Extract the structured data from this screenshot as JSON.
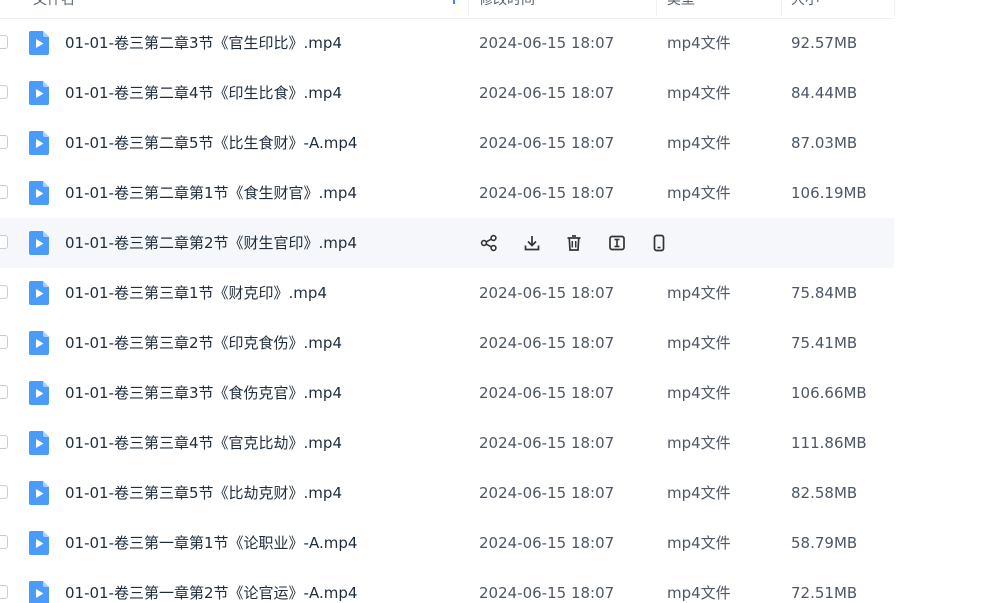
{
  "header": {
    "name_label": "文件名",
    "modified_label": "修改时间",
    "type_label": "类型",
    "size_label": "大小"
  },
  "colors": {
    "accent": "#3b8cf7",
    "icon_blue": "#4a9cf8",
    "hover_row": "#f5f7fa"
  },
  "rows": [
    {
      "name": "01-01-卷三第二章3节《官生印比》.mp4",
      "modified": "2024-06-15 18:07",
      "type": "mp4文件",
      "size": "92.57MB"
    },
    {
      "name": "01-01-卷三第二章4节《印生比食》.mp4",
      "modified": "2024-06-15 18:07",
      "type": "mp4文件",
      "size": "84.44MB"
    },
    {
      "name": "01-01-卷三第二章5节《比生食财》-A.mp4",
      "modified": "2024-06-15 18:07",
      "type": "mp4文件",
      "size": "87.03MB"
    },
    {
      "name": "01-01-卷三第二章第1节《食生财官》.mp4",
      "modified": "2024-06-15 18:07",
      "type": "mp4文件",
      "size": "106.19MB"
    },
    {
      "name": "01-01-卷三第二章第2节《财生官印》.mp4",
      "modified": "",
      "type": "",
      "size": "",
      "hover": true
    },
    {
      "name": "01-01-卷三第三章1节《财克印》.mp4",
      "modified": "2024-06-15 18:07",
      "type": "mp4文件",
      "size": "75.84MB"
    },
    {
      "name": "01-01-卷三第三章2节《印克食伤》.mp4",
      "modified": "2024-06-15 18:07",
      "type": "mp4文件",
      "size": "75.41MB"
    },
    {
      "name": "01-01-卷三第三章3节《食伤克官》.mp4",
      "modified": "2024-06-15 18:07",
      "type": "mp4文件",
      "size": "106.66MB"
    },
    {
      "name": "01-01-卷三第三章4节《官克比劫》.mp4",
      "modified": "2024-06-15 18:07",
      "type": "mp4文件",
      "size": "111.86MB"
    },
    {
      "name": "01-01-卷三第三章5节《比劫克财》.mp4",
      "modified": "2024-06-15 18:07",
      "type": "mp4文件",
      "size": "82.58MB"
    },
    {
      "name": "01-01-卷三第一章第1节《论职业》-A.mp4",
      "modified": "2024-06-15 18:07",
      "type": "mp4文件",
      "size": "58.79MB"
    },
    {
      "name": "01-01-卷三第一章第2节《论官运》-A.mp4",
      "modified": "2024-06-15 18:07",
      "type": "mp4文件",
      "size": "72.51MB"
    }
  ],
  "row_actions": [
    {
      "name": "share-icon"
    },
    {
      "name": "download-icon"
    },
    {
      "name": "delete-icon"
    },
    {
      "name": "rename-icon"
    },
    {
      "name": "phone-icon"
    }
  ]
}
